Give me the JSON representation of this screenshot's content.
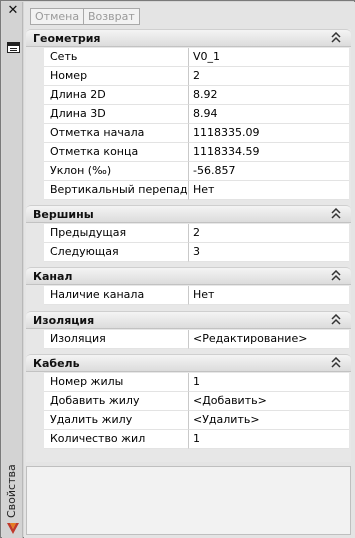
{
  "toolbar": {
    "undo_label": "Отмена",
    "redo_label": "Возврат"
  },
  "sidebar": {
    "title": "Свойства"
  },
  "categories": [
    {
      "label": "Геометрия",
      "rows": [
        {
          "name": "Сеть",
          "value": "V0_1"
        },
        {
          "name": "Номер",
          "value": "2"
        },
        {
          "name": "Длина 2D",
          "value": "8.92"
        },
        {
          "name": "Длина 3D",
          "value": "8.94"
        },
        {
          "name": "Отметка начала",
          "value": "1118335.09"
        },
        {
          "name": "Отметка конца",
          "value": "1118334.59"
        },
        {
          "name": "Уклон (‰)",
          "value": "-56.857"
        },
        {
          "name": "Вертикальный перепад",
          "value": "Нет"
        }
      ]
    },
    {
      "label": "Вершины",
      "rows": [
        {
          "name": "Предыдущая",
          "value": "2"
        },
        {
          "name": "Следующая",
          "value": "3"
        }
      ]
    },
    {
      "label": "Канал",
      "rows": [
        {
          "name": "Наличие канала",
          "value": "Нет"
        }
      ]
    },
    {
      "label": "Изоляция",
      "rows": [
        {
          "name": "Изоляция",
          "value": "<Редактирование>"
        }
      ]
    },
    {
      "label": "Кабель",
      "rows": [
        {
          "name": "Номер жилы",
          "value": "1"
        },
        {
          "name": "Добавить жилу",
          "value": "<Добавить>"
        },
        {
          "name": "Удалить жилу",
          "value": "<Удалить>"
        },
        {
          "name": "Количество жил",
          "value": "1"
        }
      ]
    }
  ],
  "icons": {
    "close": "close-icon",
    "panel": "properties-panel-icon",
    "collapse": "chevron-double-up-icon",
    "logo": "app-logo-icon"
  }
}
